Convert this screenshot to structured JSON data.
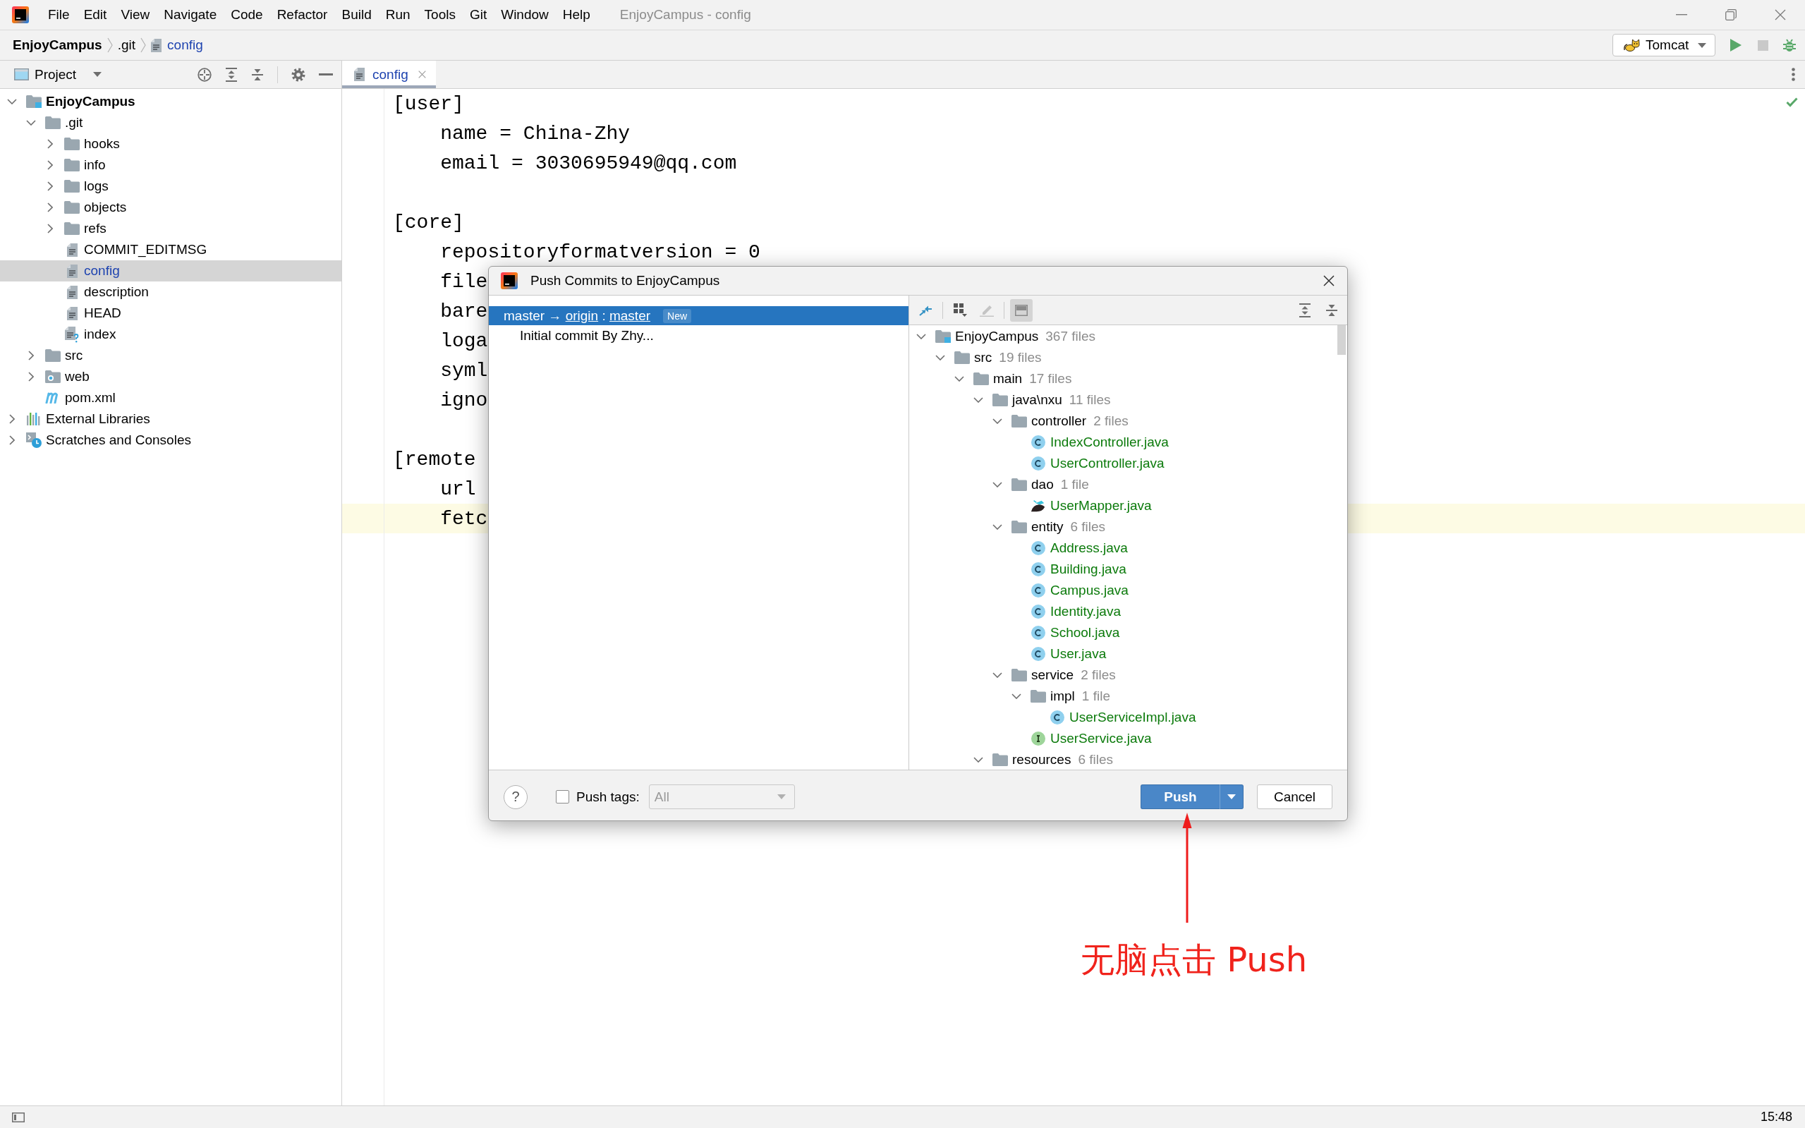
{
  "window": {
    "title": "EnjoyCampus - config",
    "menu": [
      "File",
      "Edit",
      "View",
      "Navigate",
      "Code",
      "Refactor",
      "Build",
      "Run",
      "Tools",
      "Git",
      "Window",
      "Help"
    ]
  },
  "breadcrumb": [
    {
      "label": "EnjoyCampus",
      "kind": "project",
      "modified": false
    },
    {
      "label": ".git",
      "kind": "folder",
      "modified": false
    },
    {
      "label": "config",
      "kind": "file",
      "modified": true
    }
  ],
  "run_toolbar": {
    "configuration": "Tomcat",
    "stop_disabled": true
  },
  "project_panel": {
    "title": "Project",
    "tree": [
      {
        "name": "EnjoyCampus",
        "kind": "module",
        "expanded": true,
        "selected": false,
        "modified": false,
        "children": [
          {
            "name": ".git",
            "kind": "folder",
            "expanded": true,
            "selected": false,
            "modified": false,
            "children": [
              {
                "name": "hooks",
                "kind": "folder",
                "expanded": false,
                "selected": false,
                "modified": false
              },
              {
                "name": "info",
                "kind": "folder",
                "expanded": false,
                "selected": false,
                "modified": false
              },
              {
                "name": "logs",
                "kind": "folder",
                "expanded": false,
                "selected": false,
                "modified": false
              },
              {
                "name": "objects",
                "kind": "folder",
                "expanded": false,
                "selected": false,
                "modified": false
              },
              {
                "name": "refs",
                "kind": "folder",
                "expanded": false,
                "selected": false,
                "modified": false
              },
              {
                "name": "COMMIT_EDITMSG",
                "kind": "text_file",
                "selected": false,
                "modified": false
              },
              {
                "name": "config",
                "kind": "text_file",
                "selected": true,
                "modified": true
              },
              {
                "name": "description",
                "kind": "text_file",
                "selected": false,
                "modified": false
              },
              {
                "name": "HEAD",
                "kind": "text_file",
                "selected": false,
                "modified": false
              },
              {
                "name": "index",
                "kind": "unknown_file",
                "selected": false,
                "modified": false
              }
            ]
          },
          {
            "name": "src",
            "kind": "folder",
            "expanded": false,
            "selected": false,
            "modified": false
          },
          {
            "name": "web",
            "kind": "web_folder",
            "expanded": false,
            "selected": false,
            "modified": false
          },
          {
            "name": "pom.xml",
            "kind": "maven_file",
            "selected": false,
            "modified": false
          }
        ]
      },
      {
        "name": "External Libraries",
        "kind": "libraries",
        "expanded": false,
        "selected": false,
        "modified": false
      },
      {
        "name": "Scratches and Consoles",
        "kind": "scratches",
        "expanded": false,
        "selected": false,
        "modified": false
      }
    ]
  },
  "editor": {
    "tabs": [
      {
        "label": "config",
        "selected": true,
        "modified": true
      }
    ],
    "lines": [
      {
        "kind": "header",
        "text": "[user]",
        "current": false
      },
      {
        "kind": "entry",
        "text": "name = China-Zhy",
        "current": false
      },
      {
        "kind": "entry",
        "text": "email = 3030695949@qq.com",
        "current": false
      },
      {
        "kind": "blank",
        "current": false
      },
      {
        "kind": "header",
        "text": "[core]",
        "current": false
      },
      {
        "kind": "entry",
        "text": "repositoryformatversion = 0",
        "current": false
      },
      {
        "kind": "entry",
        "text": "file",
        "current": false
      },
      {
        "kind": "entry",
        "text": "bare",
        "current": false
      },
      {
        "kind": "entry",
        "text": "loga",
        "current": false
      },
      {
        "kind": "entry",
        "text": "syml",
        "current": false
      },
      {
        "kind": "entry",
        "text": "igno",
        "current": false
      },
      {
        "kind": "blank",
        "current": false
      },
      {
        "kind": "header",
        "text": "[remote",
        "current": false
      },
      {
        "kind": "entry",
        "text": "url",
        "current": false
      },
      {
        "kind": "entry",
        "text": "fetc",
        "current": true
      }
    ]
  },
  "push_dialog": {
    "title": "Push Commits to EnjoyCampus",
    "branches": [
      {
        "local_branch": "master",
        "arrow": "→",
        "remote": "origin",
        "separator": ":",
        "remote_branch": "master",
        "badge": "New",
        "selected": true,
        "commits": [
          {
            "message": "Initial commit By Zhy...",
            "selected": false
          }
        ]
      }
    ],
    "changes_toolbar": [
      {
        "kind": "merge",
        "pressed": false,
        "disabled": false
      },
      {
        "kind": "group",
        "pressed": false,
        "disabled": false
      },
      {
        "kind": "edit",
        "pressed": false,
        "disabled": true
      },
      {
        "kind": "preview",
        "pressed": true,
        "disabled": false
      },
      {
        "kind": "expand_all",
        "pressed": false,
        "disabled": false
      },
      {
        "kind": "collapse_all",
        "pressed": false,
        "disabled": false
      }
    ],
    "changes_tree": [
      {
        "name": "EnjoyCampus",
        "count": "367 files",
        "kind": "module",
        "expanded": true,
        "added": false,
        "selected": false,
        "children": [
          {
            "name": "src",
            "count": "19 files",
            "kind": "folder",
            "expanded": true,
            "added": false,
            "selected": false,
            "children": [
              {
                "name": "main",
                "count": "17 files",
                "kind": "folder",
                "expanded": true,
                "added": false,
                "selected": false,
                "children": [
                  {
                    "name": "java\\nxu",
                    "count": "11 files",
                    "kind": "folder",
                    "expanded": true,
                    "added": false,
                    "selected": false,
                    "children": [
                      {
                        "name": "controller",
                        "count": "2 files",
                        "kind": "folder",
                        "expanded": true,
                        "added": false,
                        "selected": false,
                        "children": [
                          {
                            "name": "IndexController.java",
                            "kind": "class",
                            "added": true,
                            "selected": false
                          },
                          {
                            "name": "UserController.java",
                            "kind": "class",
                            "added": true,
                            "selected": false
                          }
                        ]
                      },
                      {
                        "name": "dao",
                        "count": "1 file",
                        "kind": "folder",
                        "expanded": true,
                        "added": false,
                        "selected": false,
                        "children": [
                          {
                            "name": "UserMapper.java",
                            "kind": "mapper",
                            "added": true,
                            "selected": false
                          }
                        ]
                      },
                      {
                        "name": "entity",
                        "count": "6 files",
                        "kind": "folder",
                        "expanded": true,
                        "added": false,
                        "selected": false,
                        "children": [
                          {
                            "name": "Address.java",
                            "kind": "class",
                            "added": true,
                            "selected": false
                          },
                          {
                            "name": "Building.java",
                            "kind": "class",
                            "added": true,
                            "selected": false
                          },
                          {
                            "name": "Campus.java",
                            "kind": "class",
                            "added": true,
                            "selected": false
                          },
                          {
                            "name": "Identity.java",
                            "kind": "class",
                            "added": true,
                            "selected": false
                          },
                          {
                            "name": "School.java",
                            "kind": "class",
                            "added": true,
                            "selected": false
                          },
                          {
                            "name": "User.java",
                            "kind": "class",
                            "added": true,
                            "selected": false
                          }
                        ]
                      },
                      {
                        "name": "service",
                        "count": "2 files",
                        "kind": "folder",
                        "expanded": true,
                        "added": false,
                        "selected": false,
                        "children": [
                          {
                            "name": "impl",
                            "count": "1 file",
                            "kind": "folder",
                            "expanded": true,
                            "added": false,
                            "selected": false,
                            "children": [
                              {
                                "name": "UserServiceImpl.java",
                                "kind": "class",
                                "added": true,
                                "selected": false
                              }
                            ]
                          },
                          {
                            "name": "UserService.java",
                            "kind": "interface",
                            "added": true,
                            "selected": false
                          }
                        ]
                      }
                    ]
                  },
                  {
                    "name": "resources",
                    "count": "6 files",
                    "kind": "folder",
                    "expanded": true,
                    "added": false,
                    "selected": false
                  }
                ]
              }
            ]
          }
        ]
      }
    ],
    "help_button": "?",
    "push_tags": {
      "label": "Push tags:",
      "checked": false,
      "value": "All",
      "disabled": true
    },
    "buttons": [
      {
        "label": "Push",
        "kind": "split_primary"
      },
      {
        "label": "Cancel",
        "kind": "plain"
      }
    ]
  },
  "annotation": {
    "text": "无脑点击 Push"
  },
  "status_bar": {
    "time": "15:48"
  }
}
